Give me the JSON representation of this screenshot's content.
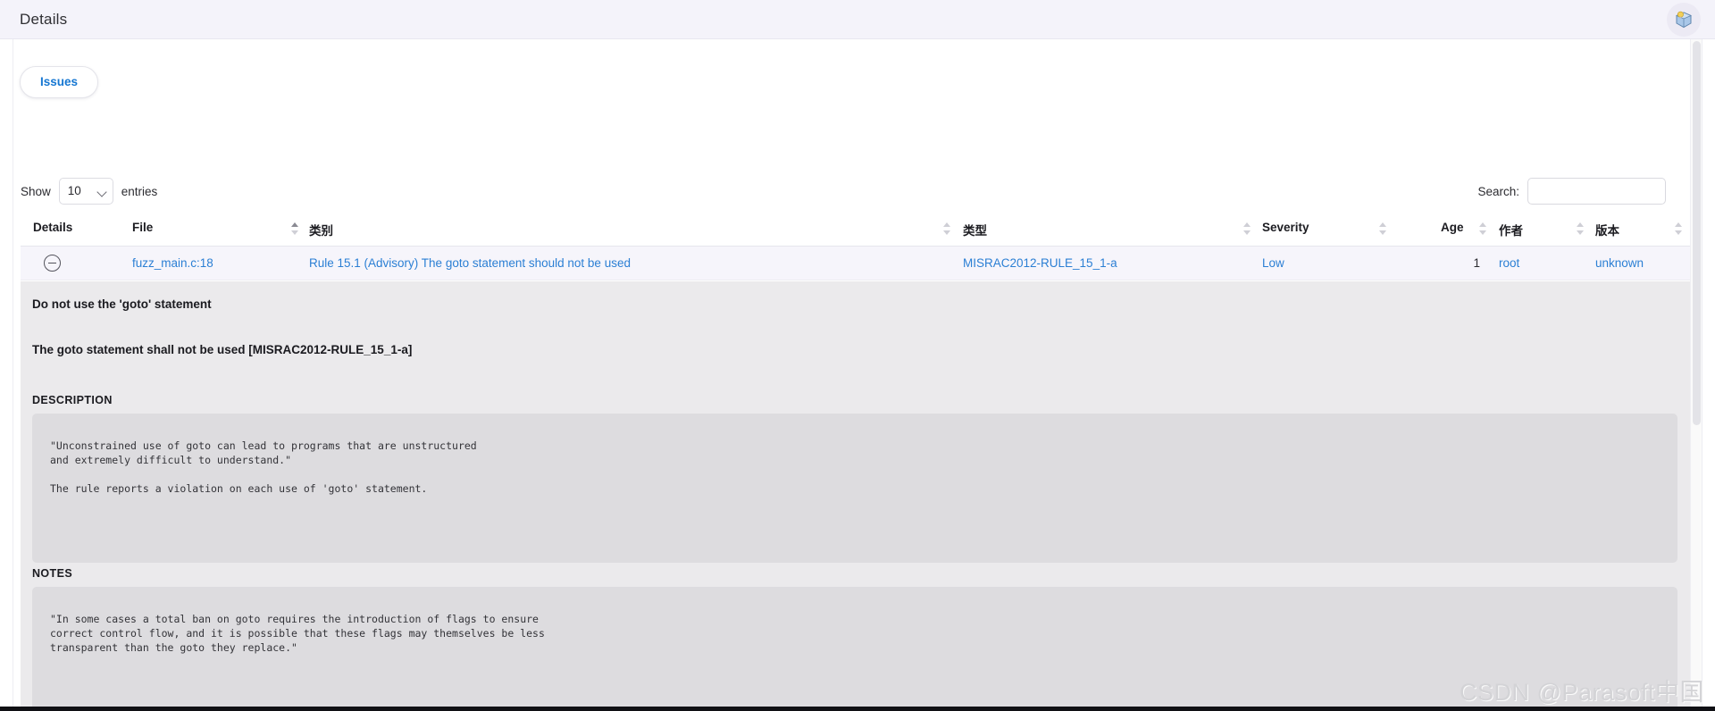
{
  "window": {
    "title": "Details",
    "avatar_icon": "parasoft-shield-bulb-logo"
  },
  "tabs": [
    {
      "label": "Issues",
      "active": true
    }
  ],
  "table_controls": {
    "show_label": "Show",
    "entries_value": "10",
    "entries_label": "entries",
    "search_label": "Search:",
    "search_value": "",
    "search_placeholder": ""
  },
  "table": {
    "columns": [
      {
        "key": "details",
        "label": "Details",
        "sortable": false,
        "sort": "none"
      },
      {
        "key": "file",
        "label": "File",
        "sortable": true,
        "sort": "asc"
      },
      {
        "key": "category",
        "label": "类别",
        "sortable": true,
        "sort": "none"
      },
      {
        "key": "type",
        "label": "类型",
        "sortable": true,
        "sort": "none"
      },
      {
        "key": "severity",
        "label": "Severity",
        "sortable": true,
        "sort": "none"
      },
      {
        "key": "age",
        "label": "Age",
        "sortable": true,
        "sort": "none"
      },
      {
        "key": "author",
        "label": "作者",
        "sortable": true,
        "sort": "none"
      },
      {
        "key": "version",
        "label": "版本",
        "sortable": true,
        "sort": "none"
      }
    ],
    "rows": [
      {
        "expand_icon": "collapse-minus-circle-icon",
        "file": "fuzz_main.c:18",
        "category": "Rule 15.1 (Advisory) The goto statement should not be used",
        "type": "MISRAC2012-RULE_15_1-a",
        "severity": "Low",
        "age": "1",
        "author": "root",
        "version": "unknown"
      }
    ]
  },
  "detail_panel": {
    "headline": "Do not use the 'goto' statement",
    "rule_statement": "The goto statement shall not be used [MISRAC2012-RULE_15_1-a]",
    "description_label": "DESCRIPTION",
    "description_text": "\"Unconstrained use of goto can lead to programs that are unstructured\nand extremely difficult to understand.\"\n\nThe rule reports a violation on each use of 'goto' statement.",
    "notes_label": "NOTES",
    "notes_text": "\"In some cases a total ban on goto requires the introduction of flags to ensure\ncorrect control flow, and it is possible that these flags may themselves be less\ntransparent than the goto they replace.\""
  },
  "watermark": {
    "text": "CSDN @Parasoft中国"
  },
  "colors": {
    "link": "#2b7fd4",
    "tab_accent": "#1677d2",
    "topbar_bg": "#f4f3fa",
    "row_bg": "#f6f5fb",
    "detail_bg": "#ebeaec",
    "code_bg": "#dddcdf"
  }
}
